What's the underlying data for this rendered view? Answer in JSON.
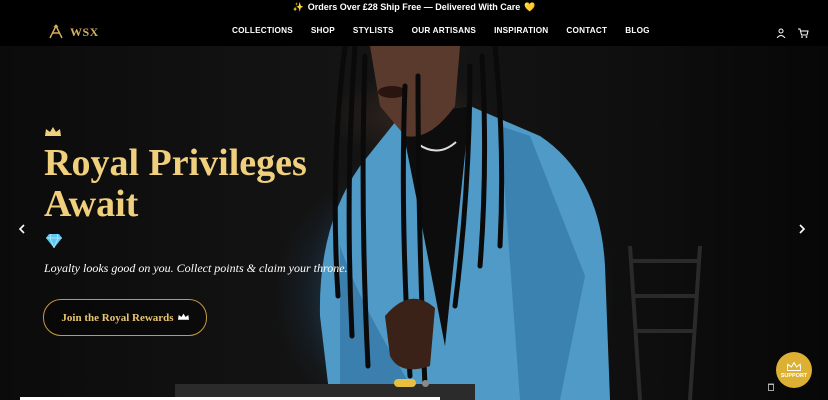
{
  "announcement": {
    "text": "Orders Over £28 Ship Free — Delivered With Care",
    "prefix_icon": "sparkles-icon",
    "suffix_icon": "yellow-heart-icon"
  },
  "header": {
    "logo_text": "WSX",
    "nav": [
      "COLLECTIONS",
      "SHOP",
      "STYLISTS",
      "OUR ARTISANS",
      "INSPIRATION",
      "CONTACT",
      "BLOG"
    ],
    "icons": [
      "account-icon",
      "cart-icon"
    ]
  },
  "hero": {
    "title_line1": "Royal Privileges",
    "title_line2": "Await",
    "subtitle": "Loyalty looks good on you. Collect points & claim your throne.",
    "cta_label": "Join the Royal Rewards",
    "slide_count": 2,
    "active_slide": 1
  },
  "support": {
    "label": "SUPPORT"
  },
  "colors": {
    "gold": "#f0cf7d",
    "accent_gold": "#dcb032",
    "background": "#000000"
  }
}
